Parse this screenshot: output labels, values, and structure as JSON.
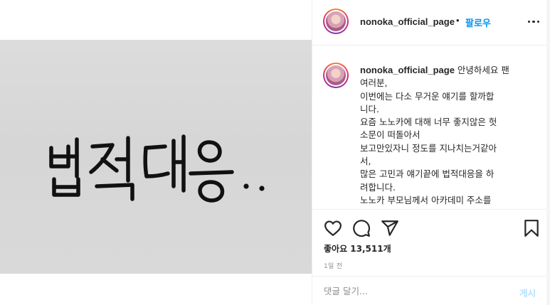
{
  "media": {
    "handwritten_text": "법적대응.."
  },
  "header": {
    "username": "nonoka_official_page",
    "dot": "•",
    "follow_label": "팔로우",
    "more_icon": "more-horizontal-icon"
  },
  "caption": {
    "username": "nonoka_official_page",
    "lines": [
      "안녕하세요 팬",
      "여러분,",
      "이번에는 다소 무거운 얘기를 할까합",
      "니다.",
      "요즘 노노카에 대해 너무 좋지않은 헛",
      "소문이 떠돌아서",
      "보고만있자니 정도를 지나치는거같아",
      "서,",
      "많은 고민과 얘기끝에 법적대응을 하",
      "려합니다.",
      "노노카 부모님께서 아카데미 주소를"
    ]
  },
  "actions": {
    "like_icon": "heart-icon",
    "comment_icon": "comment-icon",
    "share_icon": "send-icon",
    "save_icon": "bookmark-icon"
  },
  "likes_text": "좋아요 13,511개",
  "time_text": "1일 전",
  "comment": {
    "placeholder": "댓글 달기...",
    "post_label": "게시"
  },
  "colors": {
    "accent": "#0095f6",
    "post_disabled": "#b2dffc",
    "border": "#efefef",
    "muted": "#8e8e8e",
    "photo_bg": "#d9d9d9"
  }
}
